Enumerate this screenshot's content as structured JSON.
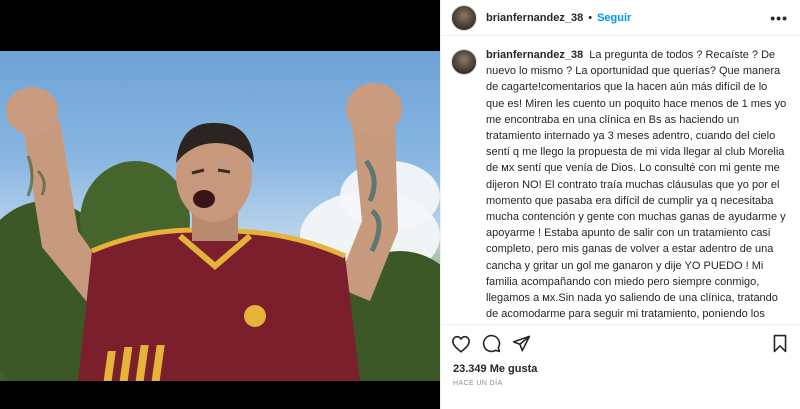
{
  "post": {
    "username": "brianfernandez_38",
    "separator": "•",
    "follow_label": "Seguir",
    "more_label": "•••",
    "likes": "23.349 Me gusta",
    "timestamp": "HACE UN DÍA"
  },
  "caption": {
    "username": "brianfernandez_38",
    "text": "La pregunta de todos ? Recaíste ? De nuevo lo mismo ? La oportunidad que querías? Que manera de cagarte!comentarios que la hacen aún más difícil de lo que es! Miren les cuento un poquito hace menos de 1 mes yo me encontraba en una clínica en Bs as haciendo un tratamiento internado ya 3 meses adentro, cuando del cielo sentí q me llego la propuesta de mi vida llegar al club Morelia de ᴍx sentí que venía de Dios. Lo consulté con mi gente me dijeron NO! El contrato traía muchas cláusulas que yo por el momento que pasaba era difícil de cumplir ya q necesitaba mucha contención y gente con muchas ganas de ayudarme y apoyarme ! Estaba apunto de salir con un tratamiento casi completo, pero mis ganas de volver a estar adentro de una cancha y gritar un gol me ganaron y dije YO PUEDO ! Mi familia acompañando con miedo pero siempre conmigo, llegamos a ᴍx.Sin nada yo saliendo de una clínica, tratando de acomodarme para seguir mi tratamiento, poniendo los entrenamientos por delante y ubicándome, en busca de casa, escuela y deporte para mi nene! Nada podía salir mal el sol para mi estaba saliendo! Pero en mi cabeza la ansiedad y todo lo que trae mi enfermedad no me dejo seguir y cometí una falta eso me llevó al otro día sentirme peor pero decidí pedir"
  },
  "colors": {
    "link_blue": "#0095f6",
    "text": "#262626",
    "muted": "#8e8e8e",
    "jersey": "#7a1f2b",
    "jersey_accent": "#e6b23a"
  },
  "icons": [
    "heart-icon",
    "comment-icon",
    "share-icon",
    "bookmark-icon",
    "more-options-icon"
  ]
}
